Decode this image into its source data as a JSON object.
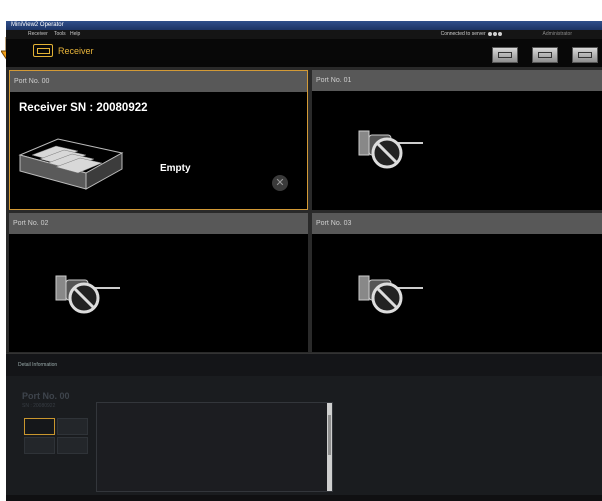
{
  "window": {
    "title": "MiniView2 Operator"
  },
  "menubar": {
    "items": [
      "Receiver",
      "Tools",
      "Help"
    ],
    "status_text": "Connected to server",
    "user": "Administrator"
  },
  "header": {
    "title": "Receiver",
    "accent": "#e8b43a"
  },
  "ports": [
    {
      "label": "Port No. 00",
      "serial": "Receiver SN : 20080922",
      "state": "Empty",
      "selected": true
    },
    {
      "label": "Port No. 01",
      "state": "not-connected"
    },
    {
      "label": "Port No. 02",
      "state": "not-connected"
    },
    {
      "label": "Port No. 03",
      "state": "not-connected"
    }
  ],
  "detail": {
    "title": "Detail Information",
    "port_label": "Port No. 00",
    "serial": "SN : 20080922"
  },
  "icons": {
    "cartridge": "cartridge-icon",
    "no_connection": "no-connection-icon",
    "close": "close-icon",
    "arrow": "down-arrow-icon"
  },
  "colors": {
    "highlight": "#d39a36",
    "arrow": "#f2a01a",
    "port_header": "#585858"
  }
}
